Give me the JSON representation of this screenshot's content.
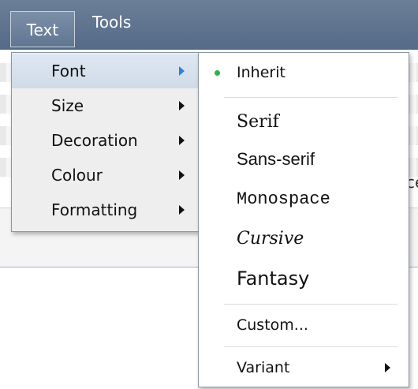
{
  "menubar": {
    "items": [
      {
        "label": "Text"
      },
      {
        "label": "Tools"
      }
    ]
  },
  "background": {
    "clipped_text_right": "ce",
    "clipped_text_left_1": "·",
    "clipped_text_left_2": "·"
  },
  "text_menu": {
    "items": [
      {
        "label": "Font",
        "has_submenu": true,
        "highlighted": true
      },
      {
        "label": "Size",
        "has_submenu": true
      },
      {
        "label": "Decoration",
        "has_submenu": true
      },
      {
        "label": "Colour",
        "has_submenu": true
      },
      {
        "label": "Formatting",
        "has_submenu": true
      }
    ]
  },
  "font_menu": {
    "items": [
      {
        "label": "Inherit",
        "selected": true
      },
      {
        "label": "Serif"
      },
      {
        "label": "Sans-serif"
      },
      {
        "label": "Monospace"
      },
      {
        "label": "Cursive"
      },
      {
        "label": "Fantasy"
      },
      {
        "label": "Custom..."
      },
      {
        "label": "Variant",
        "has_submenu": true
      }
    ]
  },
  "colors": {
    "menubar": "#5f7491",
    "highlight": "#d6e0eb",
    "selected_bullet": "#2eae4d",
    "submenu_arrow_active": "#2a7fe0"
  }
}
